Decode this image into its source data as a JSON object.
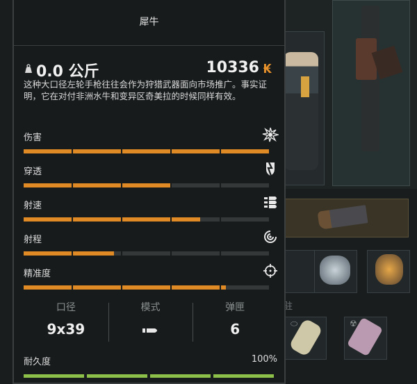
{
  "panel": {
    "title": "犀牛",
    "weight": "0.0 公斤",
    "price": "10336",
    "currency_icon": "₭",
    "description": "这种大口径左轮手枪往往会作为狩猎武器面向市场推广。事实证明，它在对付非洲水牛和变异区奇美拉的时候同样有效。",
    "stats": [
      {
        "label": "伤害",
        "icon": "explosion-icon",
        "value": 1.0
      },
      {
        "label": "穿透",
        "icon": "pierced-shield-icon",
        "value": 0.6
      },
      {
        "label": "射速",
        "icon": "bullets-icon",
        "value": 0.72
      },
      {
        "label": "射程",
        "icon": "range-arc-icon",
        "value": 0.37
      },
      {
        "label": "精准度",
        "icon": "crosshair-icon",
        "value": 0.82
      }
    ],
    "props": [
      {
        "label": "口径",
        "value": "9x39"
      },
      {
        "label": "模式",
        "value": "",
        "icon": "single-fire-icon"
      },
      {
        "label": "弹匣",
        "value": "6"
      }
    ],
    "durability_label": "耐久度",
    "durability_value": "100%",
    "durability_fraction": 1.0
  },
  "background": {
    "partial_text": "驻"
  },
  "colors": {
    "accent": "#e08a25",
    "bar_empty": "#343839",
    "durability": "#8dc049"
  }
}
